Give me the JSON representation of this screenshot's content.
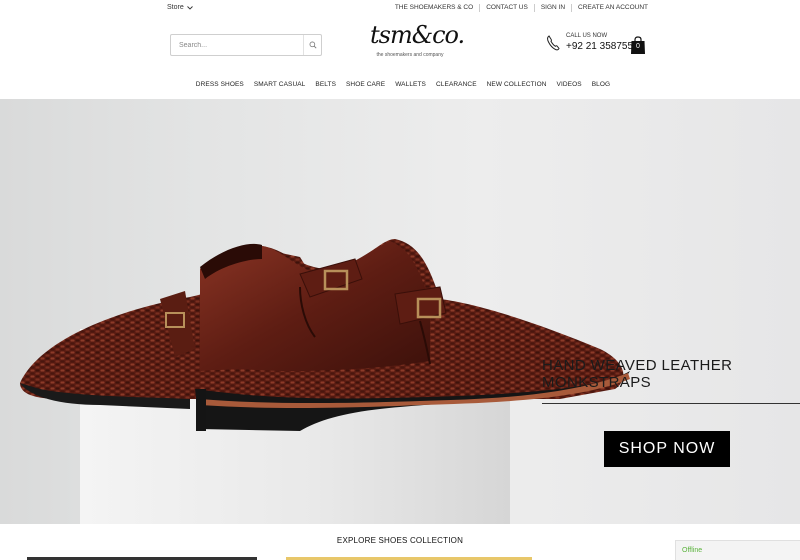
{
  "topbar": {
    "store_label": "Store",
    "links": [
      "THE SHOEMAKERS & CO",
      "CONTACT US",
      "SIGN IN",
      "CREATE AN ACCOUNT"
    ]
  },
  "header": {
    "search_placeholder": "Search...",
    "logo_text": "tsm&co.",
    "logo_tagline": "the shoemakers and company",
    "call_label": "CALL US NOW",
    "call_number": "+92 21 35875593",
    "cart_count": "0"
  },
  "nav": {
    "items": [
      "DRESS SHOES",
      "SMART CASUAL",
      "BELTS",
      "SHOE CARE",
      "WALLETS",
      "CLEARANCE",
      "NEW COLLECTION",
      "VIDEOS",
      "BLOG"
    ]
  },
  "hero": {
    "title": "HAND WEAVED LEATHER MONKSTRAPS",
    "button_label": "SHOP NOW"
  },
  "explore_title": "EXPLORE SHOES COLLECTION",
  "chat_status": "Offline",
  "colors": {
    "accent": "#000000",
    "online_status": "#5ab33b",
    "leather": "#6b2418"
  }
}
